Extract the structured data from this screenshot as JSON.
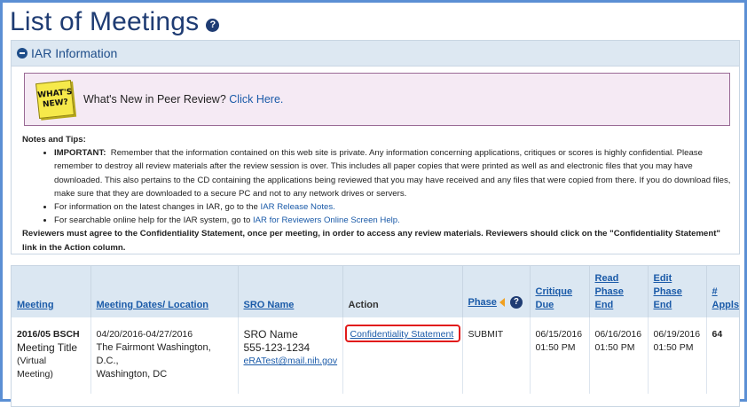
{
  "page": {
    "title": "List of Meetings",
    "help_icon": "?"
  },
  "iar": {
    "header": "IAR Information",
    "sticky_text": "WHAT'S NEW?",
    "whatsnew_text": "What's New in Peer Review?",
    "whatsnew_link": "Click Here.",
    "notes_heading": "Notes and Tips:",
    "important_label": "IMPORTANT:",
    "important_text": "Remember that the information contained on this web site is private. Any information concerning applications, critiques or scores is highly confidential. Please remember to destroy all review materials after the review session is over. This includes all paper copies that were printed as well as and electronic files that you may have downloaded. This also pertains to the CD containing the applications being reviewed that you may have received and any files that were copied from there. If you do download files, make sure that they are downloaded to a secure PC and not to any network drives or servers.",
    "info_text": "For information on the latest changes in IAR, go to the",
    "info_link": "IAR Release Notes.",
    "help_text": "For searchable online help for the IAR system, go to",
    "help_link": "IAR for Reviewers Online Screen Help.",
    "footer_bold": "Reviewers must agree to the Confidentiality Statement, once per meeting, in order to access any review materials.  Reviewers should click on the \"Confidentiality Statement\" link in the Action column."
  },
  "table": {
    "headers": {
      "meeting": "Meeting",
      "dates": "Meeting Dates/ Location",
      "sro": "SRO Name",
      "action": "Action",
      "phase": "Phase",
      "critique_1": "Critique",
      "critique_2": "Due",
      "read_1": "Read",
      "read_2": "Phase",
      "read_3": "End",
      "edit_1": "Edit",
      "edit_2": "Phase",
      "edit_3": "End",
      "appls_1": "#",
      "appls_2": "Appls"
    },
    "row": {
      "code": "2016/05 BSCH",
      "title": "Meeting Title",
      "type": "(Virtual Meeting)",
      "dates": "04/20/2016-04/27/2016",
      "location_1": "The Fairmont Washington, D.C.,",
      "location_2": "Washington, DC",
      "sro_name": "SRO Name",
      "sro_phone": "555-123-1234",
      "sro_email": "eRATest@mail.nih.gov",
      "action_link": "Confidentiality Statement",
      "phase": "SUBMIT",
      "critique_date": "06/15/2016",
      "critique_time": "01:50 PM",
      "read_date": "06/16/2016",
      "read_time": "01:50 PM",
      "edit_date": "06/19/2016",
      "edit_time": "01:50 PM",
      "appls": "64"
    }
  }
}
